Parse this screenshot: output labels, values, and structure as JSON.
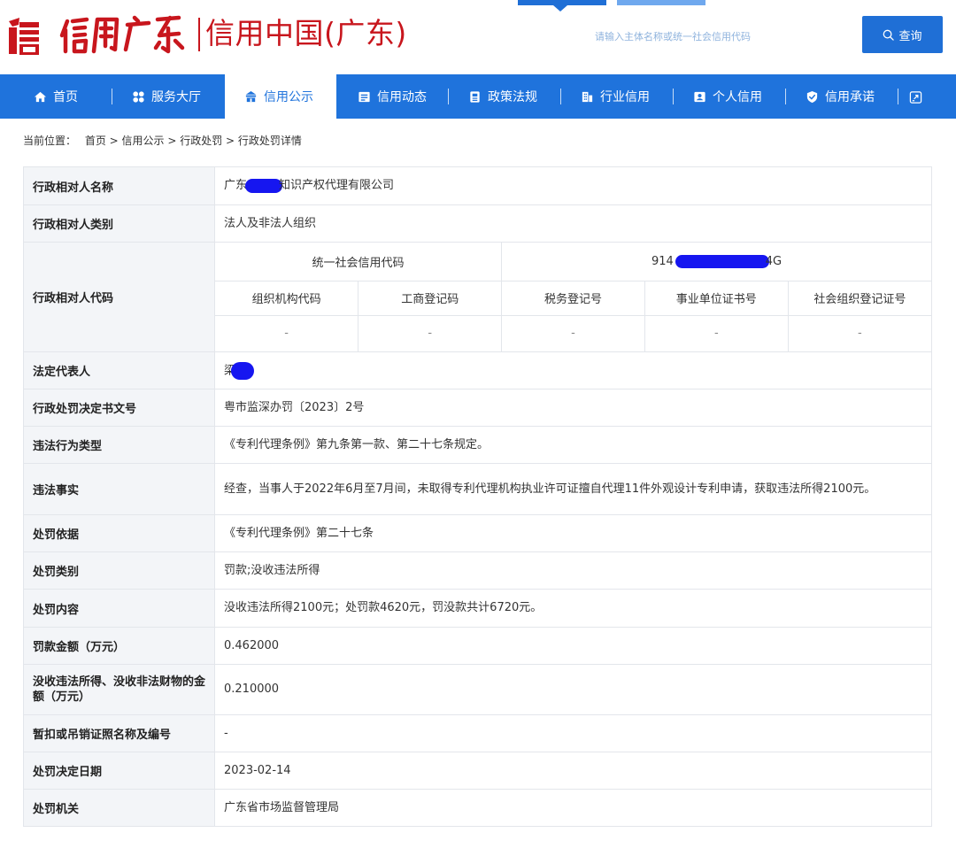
{
  "header": {
    "logo_script": "信用广东",
    "logo_subtitle": "信用中国(广东)",
    "search_placeholder": "请输入主体名称或统一社会信用代码",
    "search_button": "查询"
  },
  "nav": {
    "items": [
      {
        "label": "首页",
        "icon": "home-icon"
      },
      {
        "label": "服务大厅",
        "icon": "grid-icon"
      },
      {
        "label": "信用公示",
        "icon": "podium-icon",
        "active": true
      },
      {
        "label": "信用动态",
        "icon": "news-icon"
      },
      {
        "label": "政策法规",
        "icon": "document-icon"
      },
      {
        "label": "行业信用",
        "icon": "building-icon"
      },
      {
        "label": "个人信用",
        "icon": "id-card-icon"
      },
      {
        "label": "信用承诺",
        "icon": "shield-check-icon"
      }
    ],
    "extra_icon": "external-link-icon"
  },
  "breadcrumb": {
    "prefix": "当前位置：",
    "path": "首页 > 信用公示 > 行政处罚 > 行政处罚详情"
  },
  "detail": {
    "name_label": "行政相对人名称",
    "name_prefix": "广东",
    "name_suffix": "知识产权代理有限公司",
    "category_label": "行政相对人类别",
    "category_value": "法人及非法人组织",
    "code_label": "行政相对人代码",
    "uscc_label": "统一社会信用代码",
    "uscc_prefix": "914",
    "uscc_suffix": "4G",
    "code_headers": [
      "组织机构代码",
      "工商登记码",
      "税务登记号",
      "事业单位证书号",
      "社会组织登记证号"
    ],
    "code_values": [
      "-",
      "-",
      "-",
      "-",
      "-"
    ],
    "legal_rep_label": "法定代表人",
    "legal_rep_prefix": "梁",
    "rows": [
      {
        "label": "行政处罚决定书文号",
        "value": "粤市监深办罚〔2023〕2号"
      },
      {
        "label": "违法行为类型",
        "value": "《专利代理条例》第九条第一款、第二十七条规定。"
      },
      {
        "label": "违法事实",
        "value": "经查，当事人于2022年6月至7月间，未取得专利代理机构执业许可证擅自代理11件外观设计专利申请，获取违法所得2100元。"
      },
      {
        "label": "处罚依据",
        "value": "《专利代理条例》第二十七条"
      },
      {
        "label": "处罚类别",
        "value": "罚款;没收违法所得"
      },
      {
        "label": "处罚内容",
        "value": "没收违法所得2100元；处罚款4620元，罚没款共计6720元。"
      },
      {
        "label": "罚款金额（万元）",
        "value": "0.462000"
      },
      {
        "label": "没收违法所得、没收非法财物的金额（万元）",
        "value": "0.210000"
      },
      {
        "label": "暂扣或吊销证照名称及编号",
        "value": "-"
      },
      {
        "label": "处罚决定日期",
        "value": "2023-02-14"
      },
      {
        "label": "处罚机关",
        "value": "广东省市场监督管理局"
      }
    ]
  },
  "colors": {
    "brand_red": "#c8161d",
    "nav_blue": "#1f73dc",
    "button_blue": "#1f6fd6",
    "redaction": "#1616f0"
  }
}
